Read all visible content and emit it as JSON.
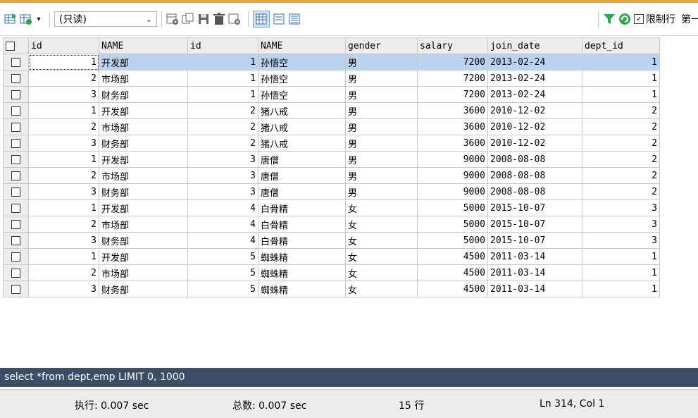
{
  "toolbar": {
    "mode": "(只读)",
    "limit_rows_label": "限制行",
    "first_row_label": "第一",
    "accent_color": "#e9a338"
  },
  "grid": {
    "columns": [
      "id",
      "NAME",
      "id",
      "NAME",
      "gender",
      "salary",
      "join_date",
      "dept_id"
    ],
    "rows": [
      [
        "1",
        "开发部",
        "1",
        "孙悟空",
        "男",
        "7200",
        "2013-02-24",
        "1"
      ],
      [
        "2",
        "市场部",
        "1",
        "孙悟空",
        "男",
        "7200",
        "2013-02-24",
        "1"
      ],
      [
        "3",
        "财务部",
        "1",
        "孙悟空",
        "男",
        "7200",
        "2013-02-24",
        "1"
      ],
      [
        "1",
        "开发部",
        "2",
        "猪八戒",
        "男",
        "3600",
        "2010-12-02",
        "2"
      ],
      [
        "2",
        "市场部",
        "2",
        "猪八戒",
        "男",
        "3600",
        "2010-12-02",
        "2"
      ],
      [
        "3",
        "财务部",
        "2",
        "猪八戒",
        "男",
        "3600",
        "2010-12-02",
        "2"
      ],
      [
        "1",
        "开发部",
        "3",
        "唐僧",
        "男",
        "9000",
        "2008-08-08",
        "2"
      ],
      [
        "2",
        "市场部",
        "3",
        "唐僧",
        "男",
        "9000",
        "2008-08-08",
        "2"
      ],
      [
        "3",
        "财务部",
        "3",
        "唐僧",
        "男",
        "9000",
        "2008-08-08",
        "2"
      ],
      [
        "1",
        "开发部",
        "4",
        "白骨精",
        "女",
        "5000",
        "2015-10-07",
        "3"
      ],
      [
        "2",
        "市场部",
        "4",
        "白骨精",
        "女",
        "5000",
        "2015-10-07",
        "3"
      ],
      [
        "3",
        "财务部",
        "4",
        "白骨精",
        "女",
        "5000",
        "2015-10-07",
        "3"
      ],
      [
        "1",
        "开发部",
        "5",
        "蜘蛛精",
        "女",
        "4500",
        "2011-03-14",
        "1"
      ],
      [
        "2",
        "市场部",
        "5",
        "蜘蛛精",
        "女",
        "4500",
        "2011-03-14",
        "1"
      ],
      [
        "3",
        "财务部",
        "5",
        "蜘蛛精",
        "女",
        "4500",
        "2011-03-14",
        "1"
      ]
    ]
  },
  "query": {
    "sql": "select *from dept,emp LIMIT 0, 1000",
    "bar_color": "#3b4e66"
  },
  "status": {
    "exec_time": "执行: 0.007 sec",
    "total_time": "总数: 0.007 sec",
    "row_count": "15 行",
    "cursor_pos": "Ln 314, Col 1"
  }
}
